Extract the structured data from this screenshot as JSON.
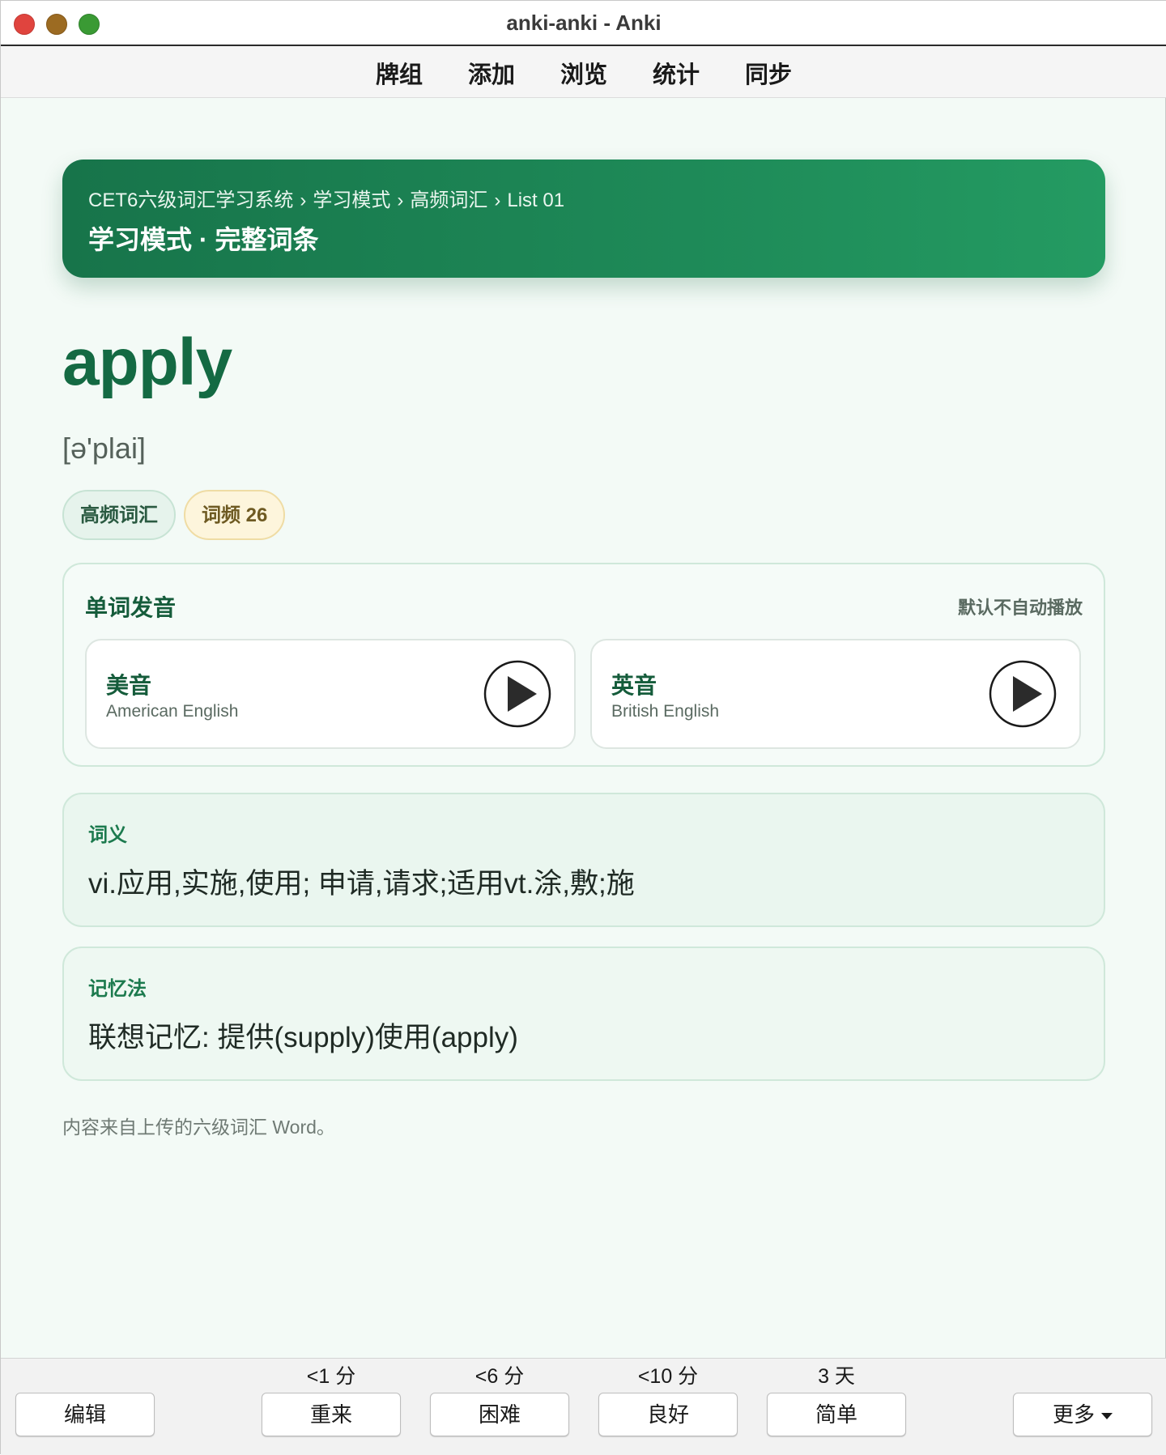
{
  "window": {
    "title": "anki-anki - Anki"
  },
  "menu": [
    "牌组",
    "添加",
    "浏览",
    "统计",
    "同步"
  ],
  "breadcrumb": {
    "items": [
      "CET6六级词汇学习系统",
      "学习模式",
      "高频词汇",
      "List 01"
    ],
    "separator": "›",
    "title": "学习模式 · 完整词条"
  },
  "card": {
    "word": "apply",
    "phonetic": "[ə'plai]",
    "tags": [
      "高频词汇",
      "词频 26"
    ],
    "pronunciation": {
      "title": "单词发音",
      "note": "默认不自动播放",
      "us": {
        "label": "美音",
        "sub": "American English"
      },
      "uk": {
        "label": "英音",
        "sub": "British English"
      }
    },
    "meaning": {
      "label": "词义",
      "text": "vi.应用,实施,使用; 申请,请求;适用vt.涂,敷;施"
    },
    "memory": {
      "label": "记忆法",
      "text": "联想记忆: 提供(supply)使用(apply)"
    },
    "source": "内容来自上传的六级词汇 Word。"
  },
  "review": {
    "edit": "编辑",
    "more": "更多",
    "answers": [
      {
        "interval": "<1 分",
        "label": "重来"
      },
      {
        "interval": "<6 分",
        "label": "困难"
      },
      {
        "interval": "<10 分",
        "label": "良好"
      },
      {
        "interval": "3 天",
        "label": "简单"
      }
    ]
  },
  "colors": {
    "accent": "#1e8a58",
    "word": "#146a43",
    "panel": "#eaf6ef"
  }
}
